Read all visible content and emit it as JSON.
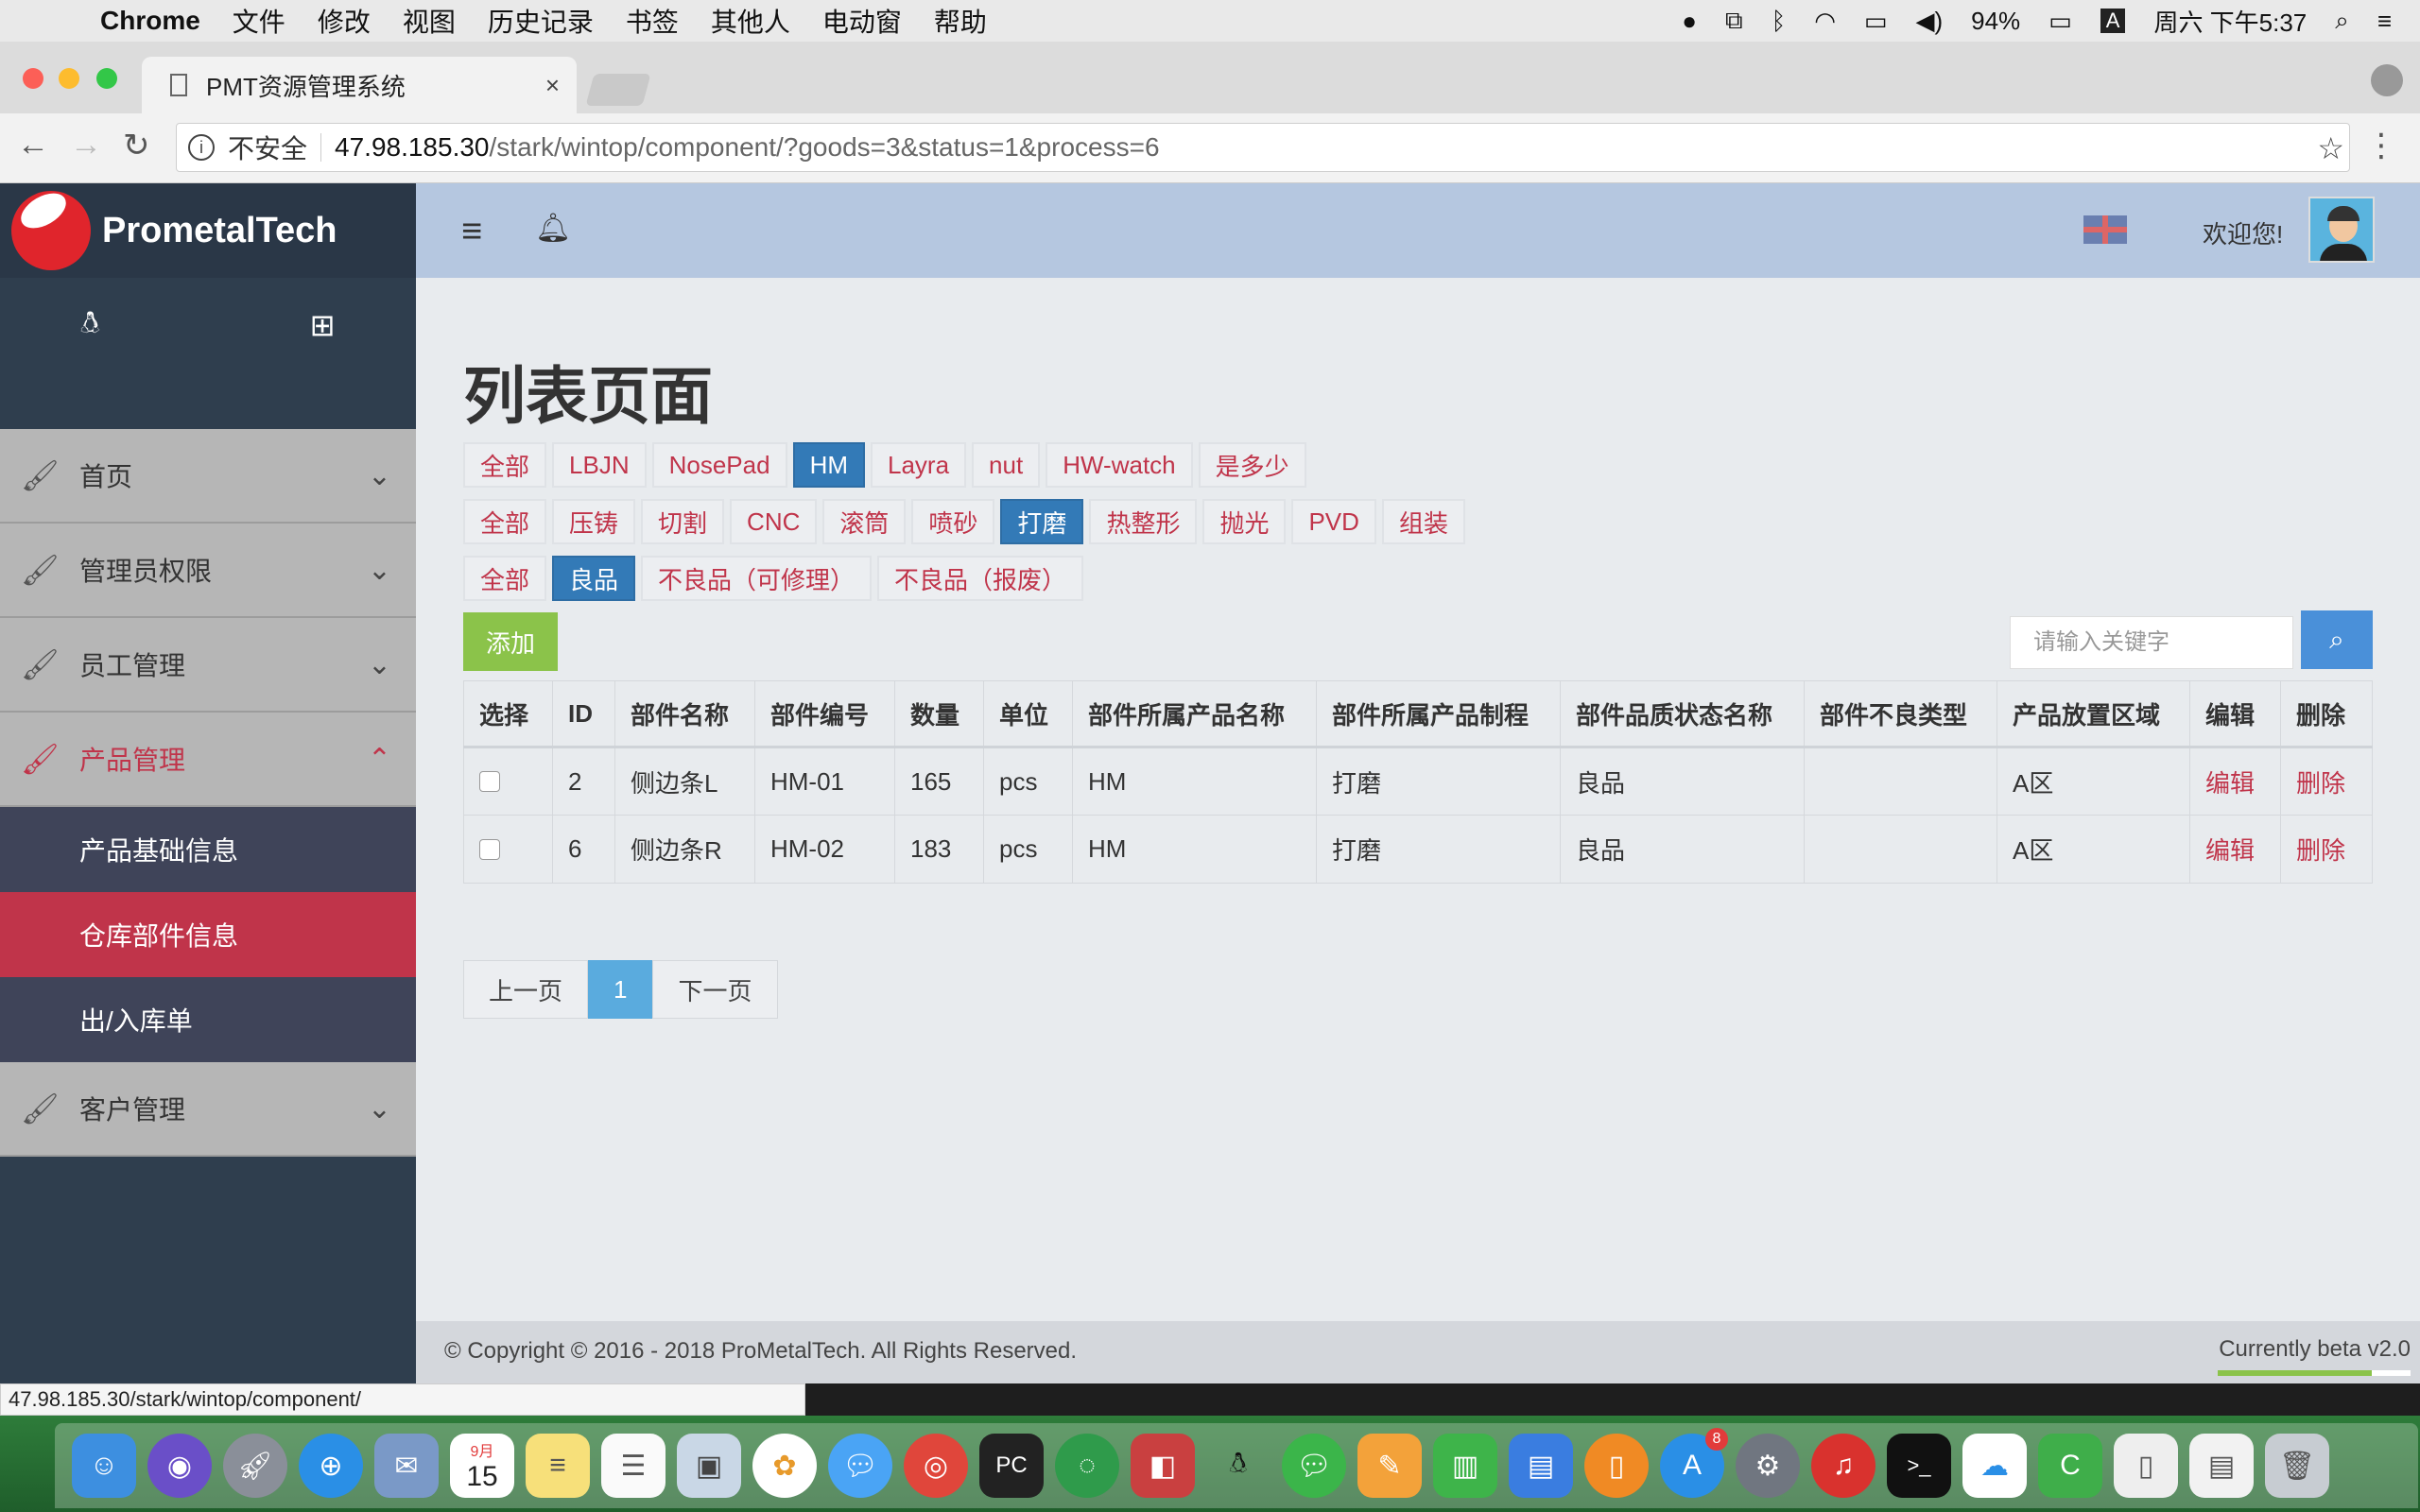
{
  "menubar": {
    "app_name": "Chrome",
    "items": [
      "文件",
      "修改",
      "视图",
      "历史记录",
      "书签",
      "其他人",
      "电动窗",
      "帮助"
    ],
    "battery": "94%",
    "input_method": "A",
    "clock": "周六 下午5:37"
  },
  "browser": {
    "tab_title": "PMT资源管理系统",
    "tab_close": "×",
    "security_label": "不安全",
    "url_host": "47.98.185.30",
    "url_path": "/stark/wintop/component/?goods=3&status=1&process=6",
    "status_url": "47.98.185.30/stark/wintop/component/"
  },
  "sidebar": {
    "logo_text": "PrometalTech",
    "menu": [
      {
        "label": "首页"
      },
      {
        "label": "管理员权限"
      },
      {
        "label": "员工管理"
      },
      {
        "label": "产品管理"
      }
    ],
    "submenu": [
      {
        "label": "产品基础信息"
      },
      {
        "label": "仓库部件信息"
      },
      {
        "label": "出/入库单"
      }
    ],
    "menu_after": {
      "label": "客户管理"
    }
  },
  "topbar": {
    "welcome": "欢迎您!"
  },
  "page": {
    "title": "列表页面",
    "filters_goods": [
      "全部",
      "LBJN",
      "NosePad",
      "HM",
      "Layra",
      "nut",
      "HW-watch",
      "是多少"
    ],
    "filters_process": [
      "全部",
      "压铸",
      "切割",
      "CNC",
      "滚筒",
      "喷砂",
      "打磨",
      "热整形",
      "抛光",
      "PVD",
      "组装"
    ],
    "filters_status": [
      "全部",
      "良品",
      "不良品（可修理）",
      "不良品（报废）"
    ],
    "add_label": "添加",
    "search_placeholder": "请输入关键字"
  },
  "table": {
    "headers": [
      "选择",
      "ID",
      "部件名称",
      "部件编号",
      "数量",
      "单位",
      "部件所属产品名称",
      "部件所属产品制程",
      "部件品质状态名称",
      "部件不良类型",
      "产品放置区域",
      "编辑",
      "删除"
    ],
    "rows": [
      [
        "",
        "2",
        "侧边条L",
        "HM-01",
        "165",
        "pcs",
        "HM",
        "打磨",
        "良品",
        "",
        "A区",
        "编辑",
        "删除"
      ],
      [
        "",
        "6",
        "侧边条R",
        "HM-02",
        "183",
        "pcs",
        "HM",
        "打磨",
        "良品",
        "",
        "A区",
        "编辑",
        "删除"
      ]
    ]
  },
  "pagination": {
    "prev": "上一页",
    "current": "1",
    "next": "下一页"
  },
  "footer": {
    "copyright": "© Copyright © 2016 - 2018 ProMetalTech. All Rights Reserved.",
    "version": "Currently beta v2.0"
  },
  "dock": {
    "calendar_month": "9月",
    "calendar_day": "15",
    "appstore_badge": "8"
  },
  "colors": {
    "accent": "#c0344a",
    "selected_filter": "#337ab7",
    "add_button": "#8bc34a",
    "topbar": "#b5c7e0",
    "sidebar": "#2f3e4e"
  }
}
